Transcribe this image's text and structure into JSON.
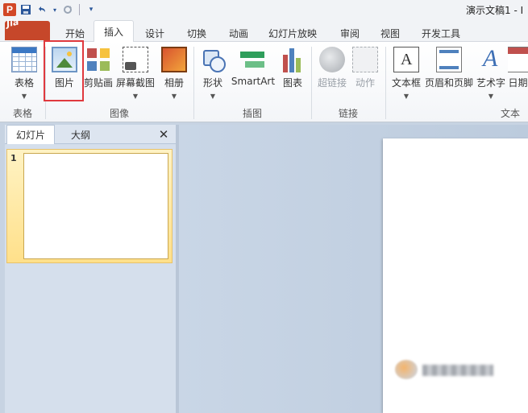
{
  "title_bar": {
    "app_icon": "P",
    "save_icon": "save-icon",
    "undo_icon": "undo-icon",
    "redo_icon": "redo-icon",
    "customize_icon": "customize-qat-icon",
    "window_title": "演示文稿1 - I"
  },
  "tabs": {
    "file_label": "开始",
    "items": [
      {
        "label": "插入"
      },
      {
        "label": "设计"
      },
      {
        "label": "切换"
      },
      {
        "label": "动画"
      },
      {
        "label": "幻灯片放映"
      },
      {
        "label": "审阅"
      },
      {
        "label": "视图"
      },
      {
        "label": "开发工具"
      }
    ],
    "active": "插入",
    "watermark": "Jia"
  },
  "ribbon": {
    "buttons": {
      "table": "表格",
      "picture": "图片",
      "clipart": "剪贴画",
      "screenshot": "屏幕截图",
      "album": "相册",
      "shapes": "形状",
      "smartart": "SmartArt",
      "chart": "图表",
      "hyperlink": "超链接",
      "action": "动作",
      "textbox": "文本框",
      "header_footer": "页眉和页脚",
      "wordart": "艺术字",
      "date": "日期"
    },
    "groups": {
      "tables": "表格",
      "images": "图像",
      "illustrations": "插图",
      "links": "链接",
      "text": "文本"
    }
  },
  "left_panel": {
    "tab_slides": "幻灯片",
    "tab_outline": "大纲",
    "close_glyph": "✕",
    "slides": [
      {
        "number": "1"
      }
    ]
  },
  "colors": {
    "file_tab": "#c6472a",
    "highlight": "#e0393e",
    "selected_thumb": "#ffe08a"
  }
}
